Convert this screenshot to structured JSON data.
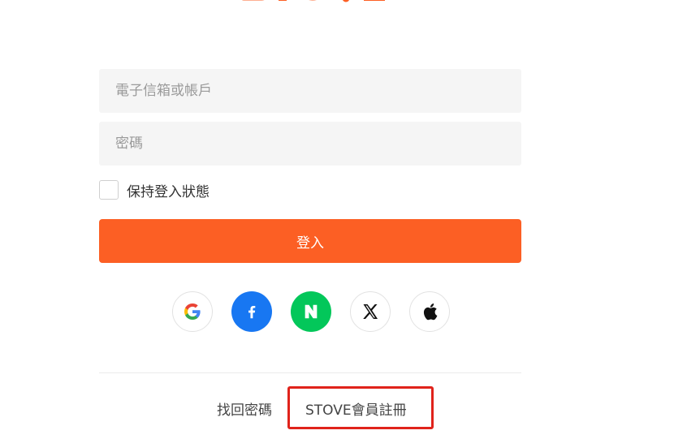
{
  "logo": {
    "text": "STOVE",
    "color": "#fc5f24"
  },
  "form": {
    "email_placeholder": "電子信箱或帳戶",
    "password_placeholder": "密碼",
    "remember_label": "保持登入狀態",
    "login_label": "登入"
  },
  "social": [
    {
      "name": "google-icon"
    },
    {
      "name": "facebook-icon"
    },
    {
      "name": "naver-icon"
    },
    {
      "name": "x-icon"
    },
    {
      "name": "apple-icon"
    }
  ],
  "links": {
    "find_password": "找回密碼",
    "register": "STOVE會員註冊"
  },
  "colors": {
    "accent": "#fc5f24",
    "facebook": "#1877f2",
    "naver": "#03c75a",
    "highlight": "#e0231b"
  }
}
